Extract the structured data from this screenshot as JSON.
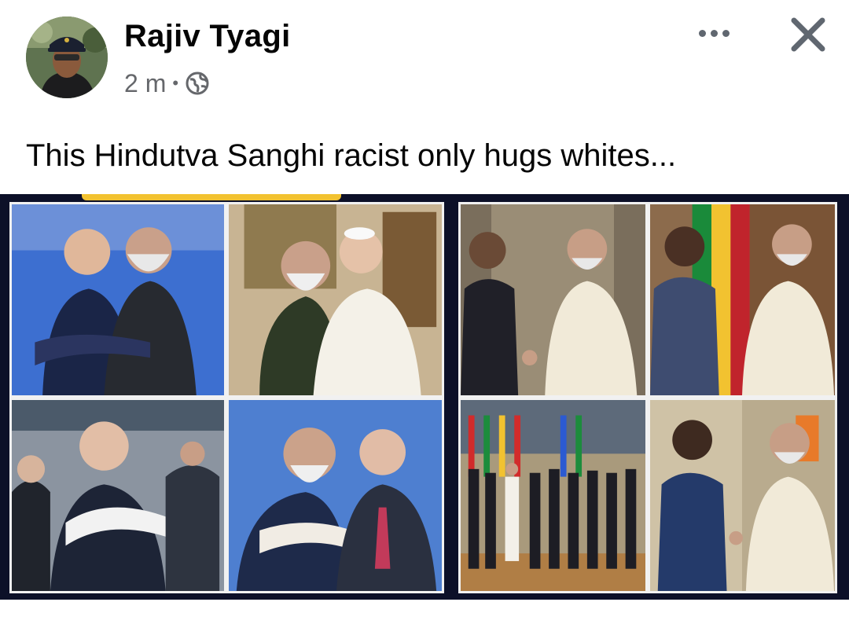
{
  "post": {
    "author": "Rajiv Tyagi",
    "timestamp": "2 m",
    "separator": "•",
    "privacy_icon": "globe-icon",
    "more_icon": "more-options-icon",
    "close_icon": "close-icon",
    "text": "This Hindutva Sanghi racist only hugs whites..."
  },
  "colors": {
    "name": "#050505",
    "meta": "#65676b",
    "icon": "#606770",
    "collage_border": "#0c1028",
    "accent_yellow": "#f2c230"
  },
  "media": {
    "type": "photo-collage",
    "panels": 8
  }
}
